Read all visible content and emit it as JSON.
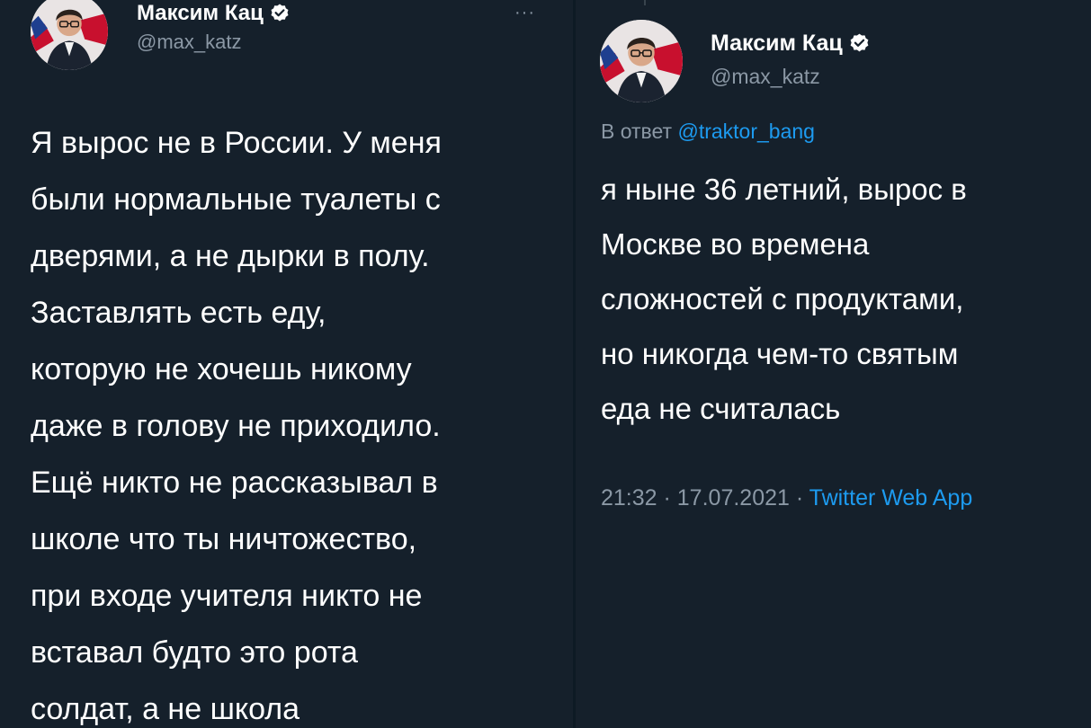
{
  "left_tweet": {
    "author": {
      "display_name": "Максим Кац",
      "handle": "@max_katz",
      "verified": true
    },
    "more_icon": "more-horizontal-icon",
    "more_label": "···",
    "text": "Я вырос не в России. У меня\nбыли нормальные туалеты с\nдверями, а не дырки в полу.\nЗаставлять есть еду,\nкоторую не хочешь никому\nдаже в голову не приходило.\nЕщё никто не рассказывал в\nшколе что ты ничтожество,\nпри входе учителя никто не\nвставал будто это рота\nсолдат, а не школа"
  },
  "right_tweet": {
    "author": {
      "display_name": "Максим Кац",
      "handle": "@max_katz",
      "verified": true
    },
    "reply_to": {
      "prefix": "В ответ ",
      "mention": "@traktor_bang"
    },
    "text": "я ныне 36 летний, вырос в\nМоскве во времена\nсложностей с продуктами,\nно никогда чем-то святым\nеда не считалась",
    "time": "21:32",
    "separator": " · ",
    "date": "17.07.2021",
    "source": "Twitter Web App"
  },
  "colors": {
    "background": "#15202b",
    "text_primary": "#ffffff",
    "text_secondary": "#8b98a5",
    "accent": "#1d9bf0"
  }
}
